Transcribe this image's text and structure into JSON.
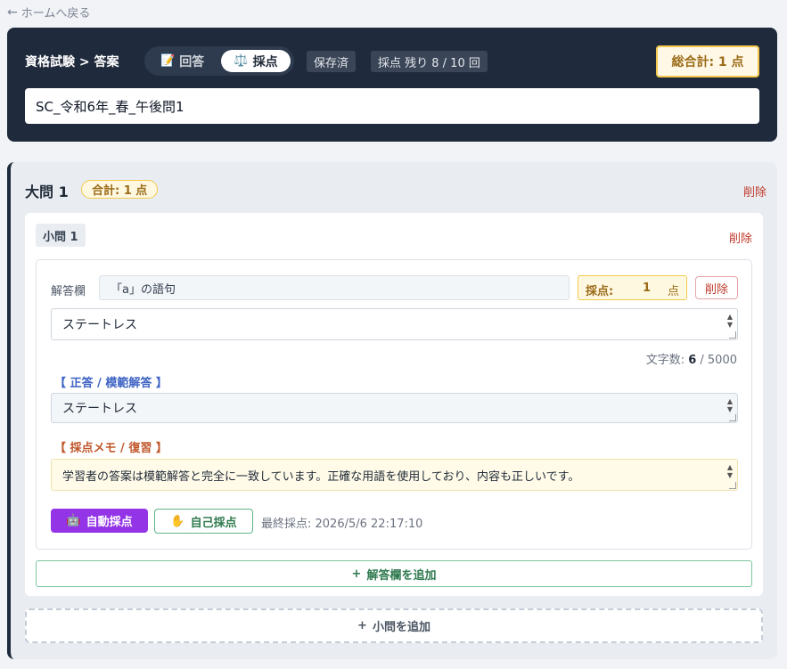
{
  "nav": {
    "back_label": "ホームへ戻る"
  },
  "header": {
    "breadcrumb": "資格試験 > 答案",
    "mode_tabs": [
      {
        "label": "回答",
        "icon": "memo-icon",
        "active": false
      },
      {
        "label": "採点",
        "icon": "scale-icon",
        "active": true
      }
    ],
    "save_status": "保存済",
    "grading_remaining": "採点 残り 8 / 10 回",
    "grand_total": "総合計: 1 点",
    "title_value": "SC_令和6年_春_午後問1"
  },
  "question": {
    "title": "大問 1",
    "subtotal": "合計: 1 点",
    "delete_label": "削除",
    "sub_question": {
      "title": "小問 1",
      "delete_label": "削除",
      "answer_field": {
        "label": "解答欄",
        "name_value": "「a」の語句",
        "score_label": "採点:",
        "score_value": "1",
        "score_unit": "点",
        "delete_label": "削除",
        "answer_value": "ステートレス",
        "char_count_prefix": "文字数: ",
        "char_count": "6",
        "char_limit": " / 5000",
        "model_answer_label": "【 正答 / 模範解答 】",
        "model_answer_value": "ステートレス",
        "memo_label": "【 採点メモ / 復習 】",
        "memo_value": "学習者の答案は模範解答と完全に一致しています。正確な用語を使用しており、内容も正しいです。",
        "auto_grade_label": "自動採点",
        "self_grade_label": "自己採点",
        "last_graded": "最終採点: 2026/5/6 22:17:10"
      },
      "add_answer_label": "解答欄を追加"
    },
    "add_sub_label": "小問を追加"
  },
  "colors": {
    "header_bg": "#1f2a3c",
    "accent_gold": "#f2c94c",
    "danger": "#c0392b",
    "auto_grade": "#9334e6",
    "self_grade": "#2f7a4f"
  }
}
